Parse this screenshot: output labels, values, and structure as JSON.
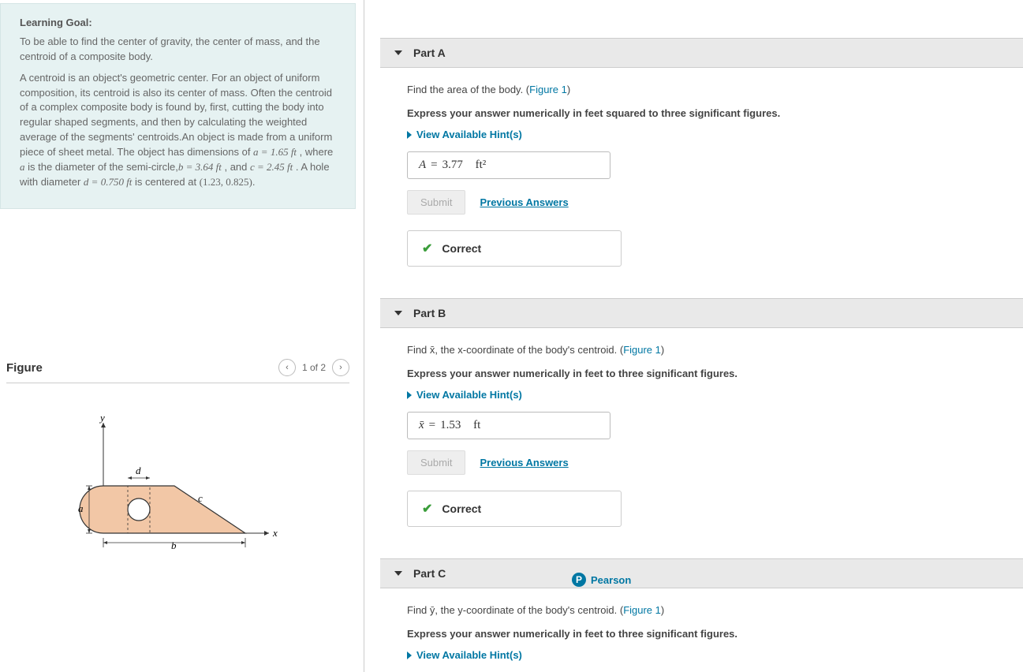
{
  "goal": {
    "title": "Learning Goal:",
    "para1": "To be able to find the center of gravity, the center of mass, and the centroid of a composite body.",
    "para2_prefix": "A centroid is an object's geometric center. For an object of uniform composition, its centroid is also its center of mass. Often the centroid of a complex composite body is found by, first, cutting the body into regular shaped segments, and then by calculating the weighted average of the segments' centroids.An object is made from a uniform piece of sheet metal. The object has dimensions of ",
    "a_eq": "a = 1.65 ft",
    "mid1": " , where ",
    "a_var": "a",
    "mid2": " is the diameter of the semi-circle,",
    "b_eq": "b = 3.64 ft",
    "mid3": " , and ",
    "c_eq": "c = 2.45 ft",
    "mid4": " . A hole with diameter ",
    "d_eq": "d = 0.750 ft",
    "mid5": " is centered at ",
    "coord": "(1.23, 0.825)",
    "end": "."
  },
  "figure": {
    "title": "Figure",
    "counter": "1 of 2",
    "labels": {
      "y": "y",
      "x": "x",
      "a": "a",
      "b": "b",
      "c": "c",
      "d": "d"
    }
  },
  "common": {
    "hints": "View Available Hint(s)",
    "submit": "Submit",
    "prev": "Previous Answers",
    "correct": "Correct",
    "figlink": "Figure 1"
  },
  "parts": {
    "A": {
      "title": "Part A",
      "prompt_pre": "Find the area of the body. (",
      "prompt_post": ")",
      "instr": "Express your answer numerically in feet squared to three significant figures.",
      "var": "A",
      "eq": "=",
      "val": "3.77",
      "unit": "ft²",
      "has_feedback": true
    },
    "B": {
      "title": "Part B",
      "prompt_pre": "Find x̄, the x-coordinate of the body's centroid. (",
      "prompt_post": ")",
      "instr": "Express your answer numerically in feet to three significant figures.",
      "var": "x̄",
      "eq": "=",
      "val": "1.53",
      "unit": "ft",
      "has_feedback": true
    },
    "C": {
      "title": "Part C",
      "prompt_pre": "Find ȳ, the y-coordinate of the body's centroid. (",
      "prompt_post": ")",
      "instr": "Express your answer numerically in feet to three significant figures."
    }
  },
  "footer": {
    "brand": "Pearson"
  }
}
